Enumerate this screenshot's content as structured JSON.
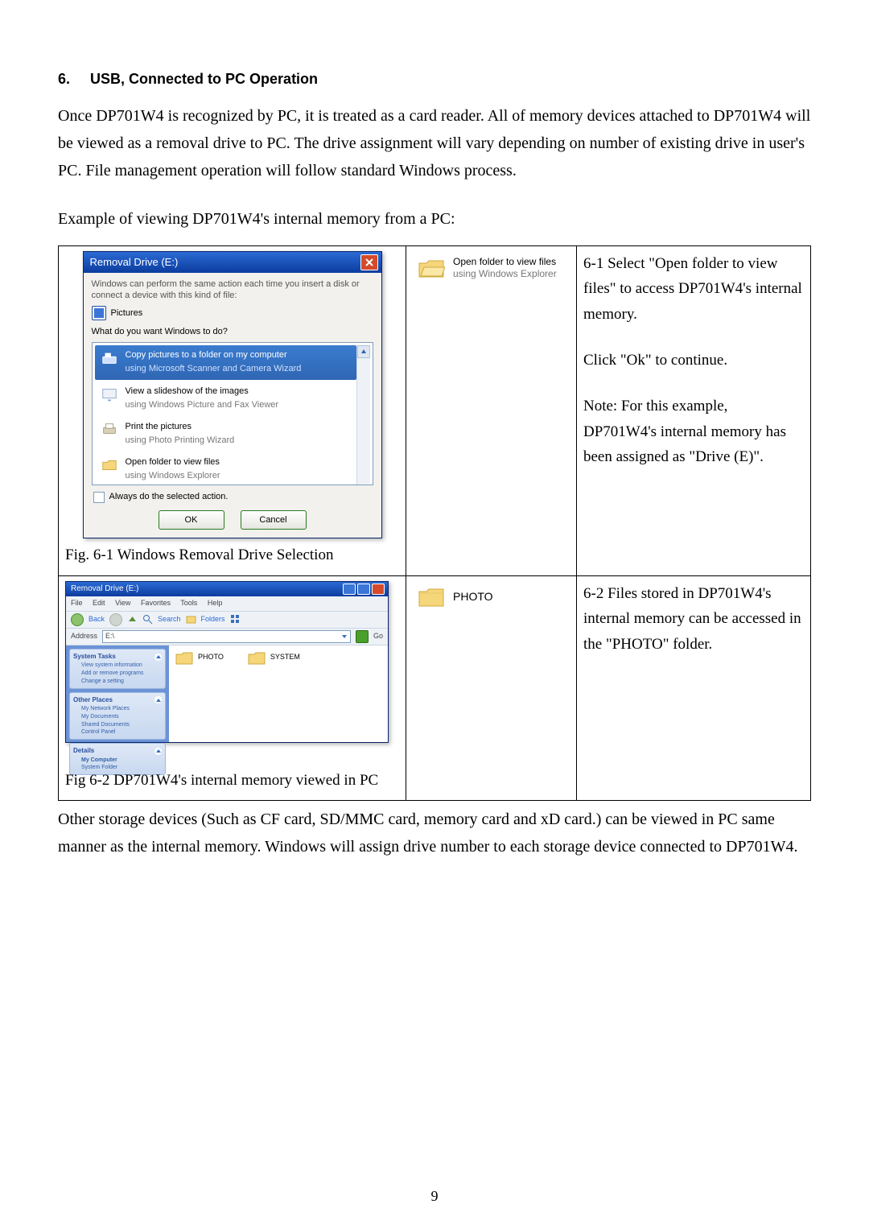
{
  "section": {
    "number": "6.",
    "title": "USB, Connected to PC Operation"
  },
  "para1": "Once DP701W4 is recognized by PC, it is treated as a card reader. All of memory devices attached to DP701W4 will be viewed as a removal drive to PC. The drive assignment will vary depending on number of existing drive in user's PC. File management operation will follow standard Windows process.",
  "para2": "Example of viewing DP701W4's internal memory from a PC:",
  "para3": "Other storage devices (Such as CF card, SD/MMC card, memory card and xD card.) can be viewed in PC same manner as the internal memory. Windows will assign drive number to each storage device connected to DP701W4.",
  "page_number": "9",
  "step61": {
    "l1": "6-1 Select \"Open folder to view files\" to access DP701W4's internal memory.",
    "l2": "Click \"Ok\" to continue.",
    "l3": "Note: For this example, DP701W4's internal memory has been assigned as \"Drive (E)\"."
  },
  "step62": {
    "l1": "6-2 Files stored in DP701W4's internal memory can be accessed in the \"PHOTO\" folder."
  },
  "fig61_caption": "Fig. 6-1 Windows Removal Drive Selection",
  "fig62_caption": "Fig 6-2 DP701W4's internal memory viewed in PC",
  "col2_row1": {
    "line1": "Open folder to view files",
    "line2": "using Windows Explorer"
  },
  "col2_row2": {
    "label": "PHOTO"
  },
  "autoplay": {
    "title": "Removal Drive (E:)",
    "subtext": "Windows can perform the same action each time you insert a disk or connect a device with this kind of file:",
    "file_type_label": "Pictures",
    "prompt": "What do you want Windows to do?",
    "options": [
      {
        "title": "Copy pictures to a folder on my computer",
        "sub": "using Microsoft Scanner and Camera Wizard"
      },
      {
        "title": "View a slideshow of the images",
        "sub": "using Windows Picture and Fax Viewer"
      },
      {
        "title": "Print the pictures",
        "sub": "using Photo Printing Wizard"
      },
      {
        "title": "Open folder to view files",
        "sub": "using Windows Explorer"
      }
    ],
    "always": "Always do the selected action.",
    "ok": "OK",
    "cancel": "Cancel"
  },
  "explorer": {
    "title": "Removal Drive (E:)",
    "menu": [
      "File",
      "Edit",
      "View",
      "Favorites",
      "Tools",
      "Help"
    ],
    "back": "Back",
    "search": "Search",
    "folders": "Folders",
    "address_label": "Address",
    "address_value": "E:\\",
    "go": "Go",
    "panels": {
      "system_tasks": {
        "title": "System Tasks",
        "items": [
          "View system information",
          "Add or remove programs",
          "Change a setting"
        ]
      },
      "other_places": {
        "title": "Other Places",
        "items": [
          "My Network Places",
          "My Documents",
          "Shared Documents",
          "Control Panel"
        ]
      },
      "details": {
        "title": "Details",
        "items": [
          "My Computer",
          "System Folder"
        ]
      }
    },
    "content_folders": [
      "PHOTO",
      "SYSTEM"
    ]
  }
}
